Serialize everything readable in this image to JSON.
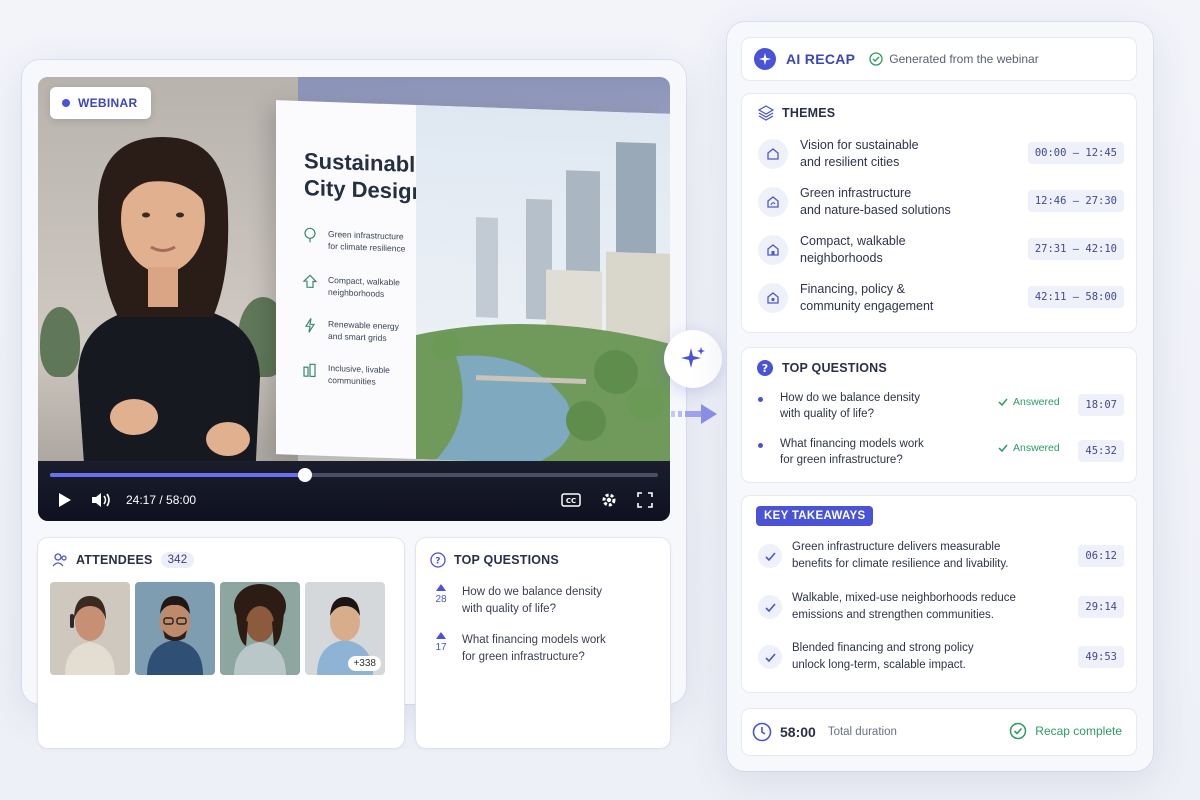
{
  "video": {
    "badge": "WEBINAR",
    "slide": {
      "title_line1": "Sustainable",
      "title_line2": "City Design",
      "bullets": [
        {
          "icon": "tree-icon",
          "line1": "Green infrastructure",
          "line2": "for climate resilience"
        },
        {
          "icon": "map-icon",
          "line1": "Compact, walkable",
          "line2": "neighborhoods"
        },
        {
          "icon": "bolt-icon",
          "line1": "Renewable energy",
          "line2": "and smart grids"
        },
        {
          "icon": "community-icon",
          "line1": "Inclusive, livable",
          "line2": "communities"
        }
      ]
    },
    "time_readout": "24:17 / 58:00",
    "progress": 0.4188,
    "colors": {
      "accent": "#4a53d6",
      "progress": "#6a6ff0",
      "success": "#2f9a64"
    }
  },
  "attendees": {
    "title": "ATTENDEES",
    "count": "342",
    "more": "+338"
  },
  "live_questions": {
    "title": "TOP QUESTIONS",
    "items": [
      {
        "votes": "28",
        "line1": "How do we balance density",
        "line2": "with quality of life?"
      },
      {
        "votes": "17",
        "line1": "What financing models work",
        "line2": "for green infrastructure?"
      }
    ]
  },
  "recap": {
    "title": "AI RECAP",
    "subtitle": "Generated from the webinar",
    "themes": {
      "title": "THEMES",
      "items": [
        {
          "line1": "Vision for sustainable",
          "line2": "and resilient cities",
          "time": "00:00 – 12:45"
        },
        {
          "line1": "Green infrastructure",
          "line2": "and nature-based solutions",
          "time": "12:46 – 27:30"
        },
        {
          "line1": "Compact, walkable",
          "line2": "neighborhoods",
          "time": "27:31 – 42:10"
        },
        {
          "line1": "Financing, policy &",
          "line2": "community engagement",
          "time": "42:11 – 58:00"
        }
      ]
    },
    "questions": {
      "title": "TOP QUESTIONS",
      "items": [
        {
          "line1": "How do we balance density",
          "line2": "with quality of life?",
          "status": "Answered",
          "time": "18:07"
        },
        {
          "line1": "What financing models work",
          "line2": "for green infrastructure?",
          "status": "Answered",
          "time": "45:32"
        }
      ]
    },
    "takeaways": {
      "title": "KEY TAKEAWAYS",
      "items": [
        {
          "line1": "Green infrastructure delivers measurable",
          "line2": "benefits for climate resilience and livability.",
          "time": "06:12"
        },
        {
          "line1": "Walkable, mixed-use neighborhoods reduce",
          "line2": "emissions and strengthen communities.",
          "time": "29:14"
        },
        {
          "line1": "Blended financing and strong policy",
          "line2": "unlock long-term, scalable impact.",
          "time": "49:53"
        }
      ]
    },
    "footer": {
      "duration": "58:00",
      "duration_label": "Total duration",
      "status": "Recap complete"
    }
  }
}
